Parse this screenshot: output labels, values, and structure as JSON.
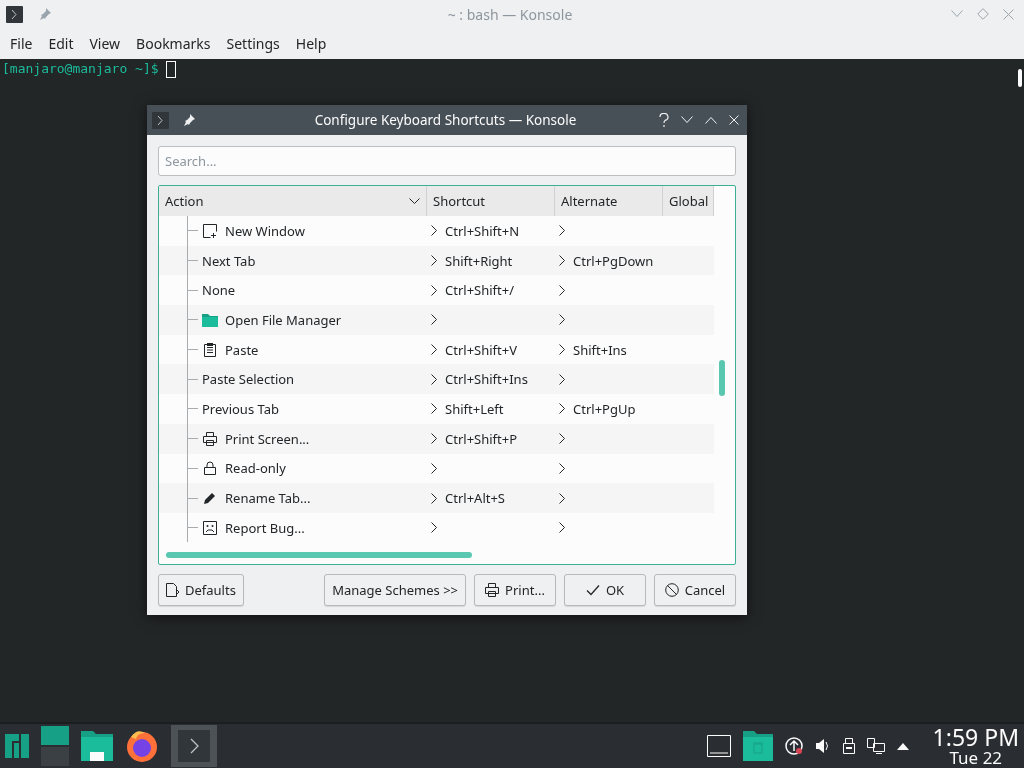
{
  "window": {
    "title": "~ : bash — Konsole"
  },
  "menu": [
    "File",
    "Edit",
    "View",
    "Bookmarks",
    "Settings",
    "Help"
  ],
  "terminal": {
    "prompt": "[manjaro@manjaro ~]$"
  },
  "dialog": {
    "title": "Configure Keyboard Shortcuts — Konsole",
    "search": {
      "placeholder": "Search..."
    },
    "table": {
      "columns": [
        "Action",
        "Shortcut",
        "Alternate",
        "Global"
      ],
      "rows": [
        {
          "action": "New Window",
          "kind": "new-window",
          "shortcut": "Ctrl+Shift+N",
          "alternate": ""
        },
        {
          "action": "Next Tab",
          "kind": "none",
          "shortcut": "Shift+Right",
          "alternate": "Ctrl+PgDown"
        },
        {
          "action": "None",
          "kind": "none",
          "shortcut": "Ctrl+Shift+/",
          "alternate": ""
        },
        {
          "action": "Open File Manager",
          "kind": "folder",
          "shortcut": "",
          "alternate": ""
        },
        {
          "action": "Paste",
          "kind": "clipboard",
          "shortcut": "Ctrl+Shift+V",
          "alternate": "Shift+Ins"
        },
        {
          "action": "Paste Selection",
          "kind": "none",
          "shortcut": "Ctrl+Shift+Ins",
          "alternate": ""
        },
        {
          "action": "Previous Tab",
          "kind": "none",
          "shortcut": "Shift+Left",
          "alternate": "Ctrl+PgUp"
        },
        {
          "action": "Print Screen...",
          "kind": "printer",
          "shortcut": "Ctrl+Shift+P",
          "alternate": ""
        },
        {
          "action": "Read-only",
          "kind": "lock",
          "shortcut": "",
          "alternate": ""
        },
        {
          "action": "Rename Tab...",
          "kind": "pencil",
          "shortcut": "Ctrl+Alt+S",
          "alternate": ""
        },
        {
          "action": "Report Bug...",
          "kind": "face",
          "shortcut": "",
          "alternate": ""
        }
      ]
    },
    "buttons": [
      {
        "label": "Defaults",
        "kind": "defaults"
      },
      {
        "label": "Manage Schemes >>",
        "kind": "text"
      },
      {
        "label": "Print...",
        "kind": "print"
      },
      {
        "label": "OK",
        "kind": "ok"
      },
      {
        "label": "Cancel",
        "kind": "cancel"
      }
    ]
  },
  "taskbar": {
    "time": "1:59 PM",
    "date": "Tue 22"
  }
}
